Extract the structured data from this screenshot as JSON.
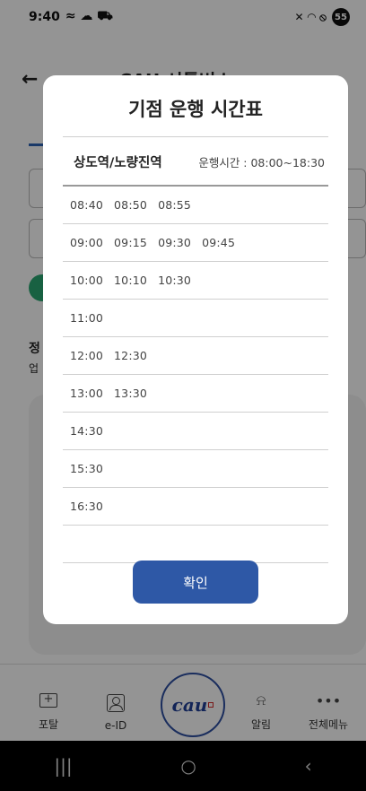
{
  "status_bar": {
    "time": "9:40",
    "battery": "55"
  },
  "app_header": {
    "title": "CAU 셔틀버스"
  },
  "background": {
    "section_title": "정",
    "section_sub": "업"
  },
  "modal": {
    "title": "기점 운행 시간표",
    "station": "상도역/노량진역",
    "hours": "운행시간 : 08:00~18:30",
    "schedule": [
      [
        "08:40",
        "08:50",
        "08:55"
      ],
      [
        "09:00",
        "09:15",
        "09:30",
        "09:45"
      ],
      [
        "10:00",
        "10:10",
        "10:30"
      ],
      [
        "11:00"
      ],
      [
        "12:00",
        "12:30"
      ],
      [
        "13:00",
        "13:30"
      ],
      [
        "14:30"
      ],
      [
        "15:30"
      ],
      [
        "16:30"
      ],
      []
    ],
    "confirm_label": "확인"
  },
  "bottom_nav": {
    "items": [
      {
        "label": "포탈",
        "icon": "portal-icon"
      },
      {
        "label": "e-ID",
        "icon": "id-card-icon"
      },
      {
        "label": "알림",
        "icon": "bell-icon"
      },
      {
        "label": "전체메뉴",
        "icon": "more-icon"
      }
    ],
    "center_logo": "CAU"
  }
}
